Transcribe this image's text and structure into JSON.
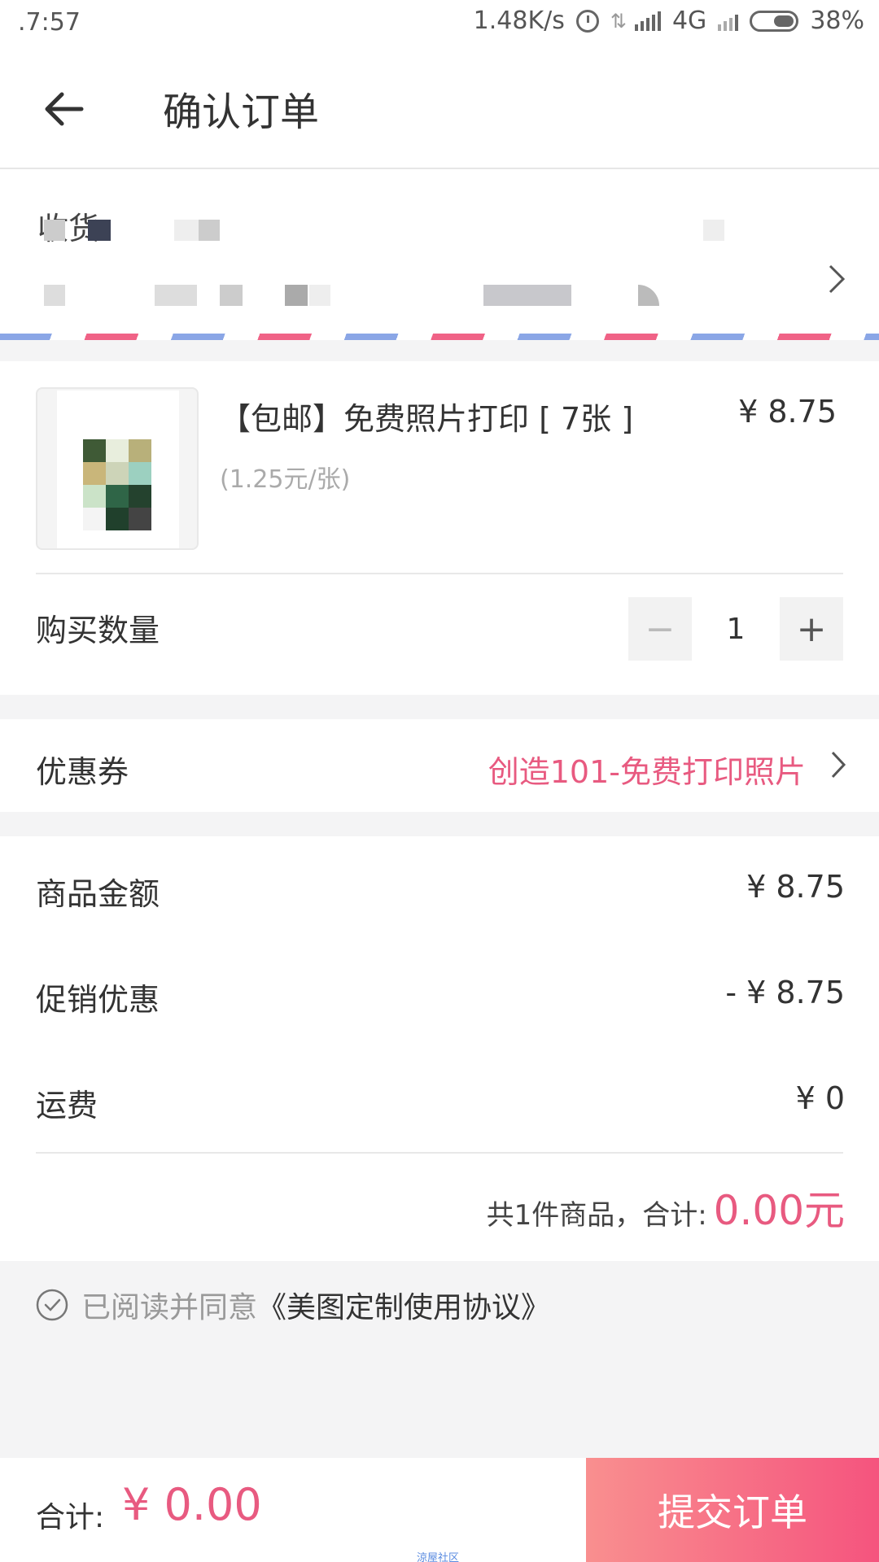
{
  "status_bar": {
    "time": ".7:57",
    "network_speed": "1.48K/s",
    "network_type": "4G",
    "battery": "38%"
  },
  "header": {
    "title": "确认订单",
    "back_icon": "back-arrow-icon"
  },
  "address": {
    "label": "收货"
  },
  "product": {
    "title": "【包邮】免费照片打印 [ 7张 ]",
    "price": "¥ 8.75",
    "unit_price": "(1.25元/张)"
  },
  "quantity": {
    "label": "购买数量",
    "minus": "−",
    "value": "1",
    "plus": "+"
  },
  "coupon": {
    "label": "优惠券",
    "value": "创造101-免费打印照片"
  },
  "summary": {
    "goods_label": "商品金额",
    "goods_value": "¥ 8.75",
    "promo_label": "促销优惠",
    "promo_value": "- ¥ 8.75",
    "shipping_label": "运费",
    "shipping_value": "¥ 0",
    "total_text": "共1件商品，合计:",
    "total_amount": "0.00元"
  },
  "agreement": {
    "text": "已阅读并同意",
    "link": "《美图定制使用协议》"
  },
  "footer": {
    "total_label": "合计:",
    "total_amount": "¥ 0.00",
    "submit_label": "提交订单"
  },
  "watermark": "涼屋社区",
  "colors": {
    "accent": "#e85a80",
    "submit_gradient_start": "#f98f8f",
    "submit_gradient_end": "#f5547e"
  }
}
